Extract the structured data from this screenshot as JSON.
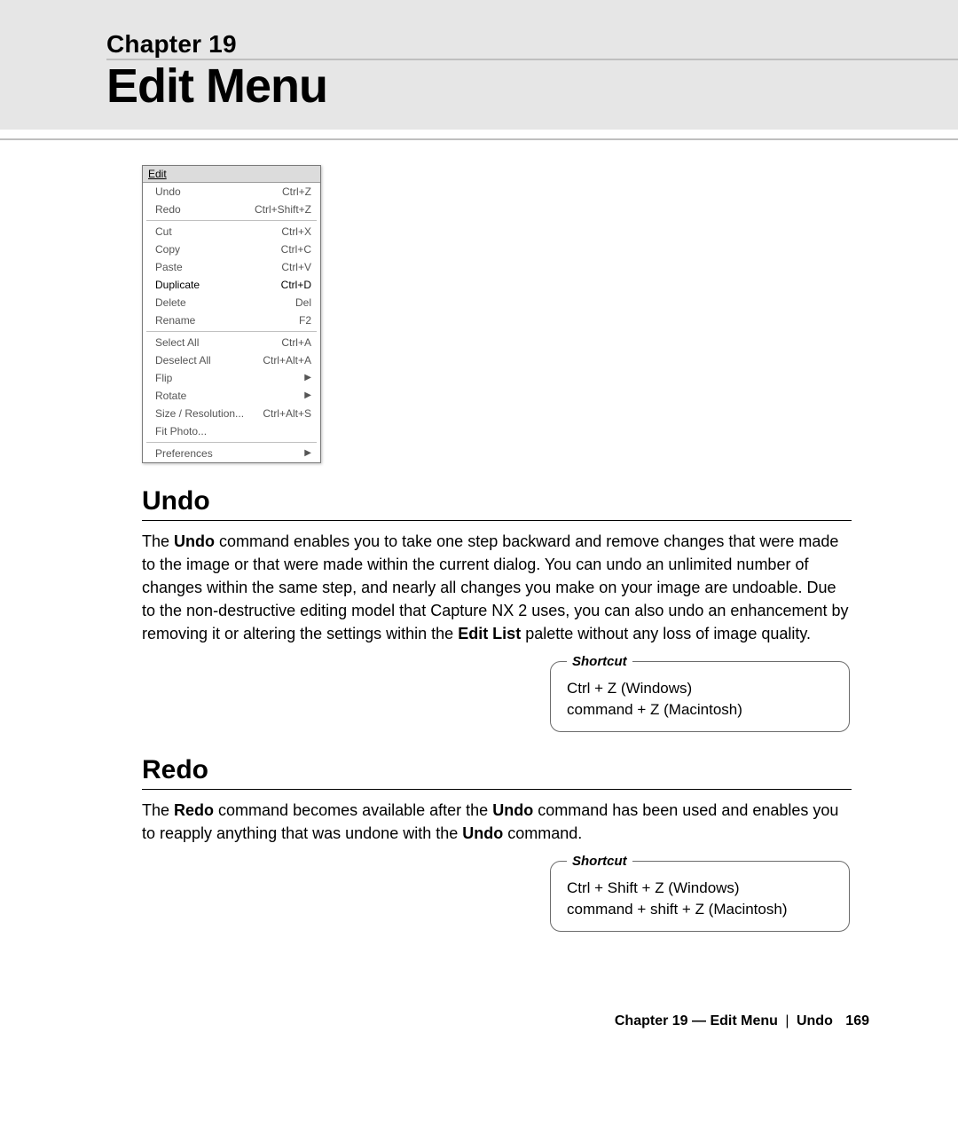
{
  "header": {
    "chapter": "Chapter 19",
    "title": "Edit Menu"
  },
  "menu": {
    "title": "Edit",
    "groups": [
      [
        {
          "label": "Undo",
          "shortcut": "Ctrl+Z"
        },
        {
          "label": "Redo",
          "shortcut": "Ctrl+Shift+Z"
        }
      ],
      [
        {
          "label": "Cut",
          "shortcut": "Ctrl+X"
        },
        {
          "label": "Copy",
          "shortcut": "Ctrl+C"
        },
        {
          "label": "Paste",
          "shortcut": "Ctrl+V"
        },
        {
          "label": "Duplicate",
          "shortcut": "Ctrl+D",
          "selected": true
        },
        {
          "label": "Delete",
          "shortcut": "Del"
        },
        {
          "label": "Rename",
          "shortcut": "F2"
        }
      ],
      [
        {
          "label": "Select All",
          "shortcut": "Ctrl+A"
        },
        {
          "label": "Deselect All",
          "shortcut": "Ctrl+Alt+A"
        },
        {
          "label": "Flip",
          "submenu": true
        },
        {
          "label": "Rotate",
          "submenu": true
        },
        {
          "label": "Size / Resolution...",
          "shortcut": "Ctrl+Alt+S"
        },
        {
          "label": "Fit Photo..."
        }
      ],
      [
        {
          "label": "Preferences",
          "submenu": true
        }
      ]
    ]
  },
  "sections": {
    "undo": {
      "heading": "Undo",
      "para_pre": "The ",
      "para_bold1": "Undo",
      "para_mid": " command enables you to take one step backward and remove changes that were made to the image or that were made within the current dialog. You can undo an unlimited number of changes within the same step, and nearly all changes you make on your image are undoable. Due to the non-destructive editing model that Capture NX 2 uses, you can also undo an enhancement by removing it or altering the settings within the ",
      "para_bold2": "Edit List",
      "para_post": " palette without any loss of image quality.",
      "shortcut_label": "Shortcut",
      "shortcut_line1": "Ctrl + Z (Windows)",
      "shortcut_line2": "command + Z (Macintosh)"
    },
    "redo": {
      "heading": "Redo",
      "para_pre": "The ",
      "para_bold1": "Redo",
      "para_mid1": " command becomes available after the ",
      "para_bold2": "Undo",
      "para_mid2": " command has been used and enables you to reapply anything that was undone with the ",
      "para_bold3": "Undo",
      "para_post": " command.",
      "shortcut_label": "Shortcut",
      "shortcut_line1": "Ctrl + Shift + Z (Windows)",
      "shortcut_line2": "command + shift + Z (Macintosh)"
    }
  },
  "footer": {
    "chapter": "Chapter 19 — Edit Menu",
    "section": "Undo",
    "page": "169"
  }
}
